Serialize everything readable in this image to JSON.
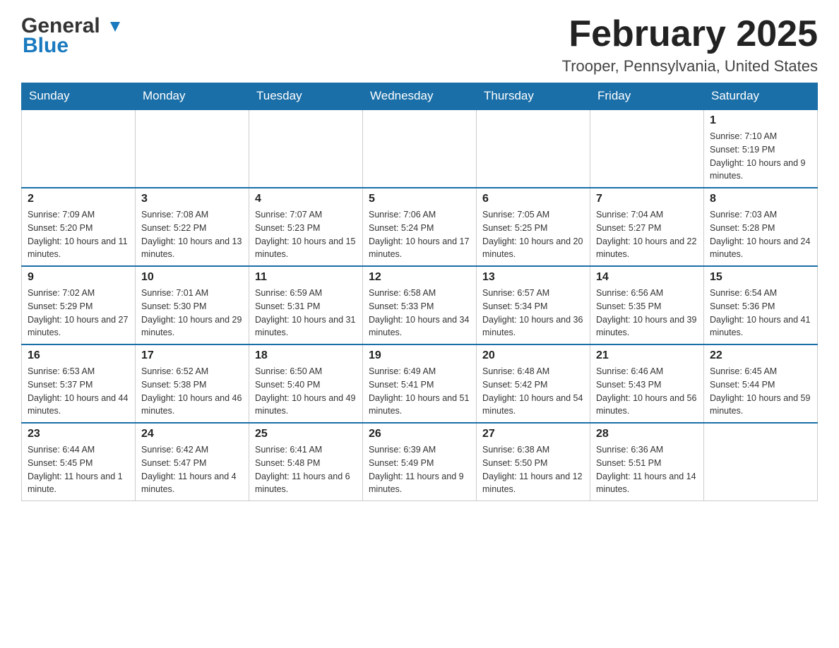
{
  "header": {
    "logo_general": "General",
    "logo_blue": "Blue",
    "month_title": "February 2025",
    "location": "Trooper, Pennsylvania, United States"
  },
  "weekdays": [
    "Sunday",
    "Monday",
    "Tuesday",
    "Wednesday",
    "Thursday",
    "Friday",
    "Saturday"
  ],
  "weeks": [
    {
      "days": [
        {
          "number": "",
          "info": ""
        },
        {
          "number": "",
          "info": ""
        },
        {
          "number": "",
          "info": ""
        },
        {
          "number": "",
          "info": ""
        },
        {
          "number": "",
          "info": ""
        },
        {
          "number": "",
          "info": ""
        },
        {
          "number": "1",
          "info": "Sunrise: 7:10 AM\nSunset: 5:19 PM\nDaylight: 10 hours and 9 minutes."
        }
      ]
    },
    {
      "days": [
        {
          "number": "2",
          "info": "Sunrise: 7:09 AM\nSunset: 5:20 PM\nDaylight: 10 hours and 11 minutes."
        },
        {
          "number": "3",
          "info": "Sunrise: 7:08 AM\nSunset: 5:22 PM\nDaylight: 10 hours and 13 minutes."
        },
        {
          "number": "4",
          "info": "Sunrise: 7:07 AM\nSunset: 5:23 PM\nDaylight: 10 hours and 15 minutes."
        },
        {
          "number": "5",
          "info": "Sunrise: 7:06 AM\nSunset: 5:24 PM\nDaylight: 10 hours and 17 minutes."
        },
        {
          "number": "6",
          "info": "Sunrise: 7:05 AM\nSunset: 5:25 PM\nDaylight: 10 hours and 20 minutes."
        },
        {
          "number": "7",
          "info": "Sunrise: 7:04 AM\nSunset: 5:27 PM\nDaylight: 10 hours and 22 minutes."
        },
        {
          "number": "8",
          "info": "Sunrise: 7:03 AM\nSunset: 5:28 PM\nDaylight: 10 hours and 24 minutes."
        }
      ]
    },
    {
      "days": [
        {
          "number": "9",
          "info": "Sunrise: 7:02 AM\nSunset: 5:29 PM\nDaylight: 10 hours and 27 minutes."
        },
        {
          "number": "10",
          "info": "Sunrise: 7:01 AM\nSunset: 5:30 PM\nDaylight: 10 hours and 29 minutes."
        },
        {
          "number": "11",
          "info": "Sunrise: 6:59 AM\nSunset: 5:31 PM\nDaylight: 10 hours and 31 minutes."
        },
        {
          "number": "12",
          "info": "Sunrise: 6:58 AM\nSunset: 5:33 PM\nDaylight: 10 hours and 34 minutes."
        },
        {
          "number": "13",
          "info": "Sunrise: 6:57 AM\nSunset: 5:34 PM\nDaylight: 10 hours and 36 minutes."
        },
        {
          "number": "14",
          "info": "Sunrise: 6:56 AM\nSunset: 5:35 PM\nDaylight: 10 hours and 39 minutes."
        },
        {
          "number": "15",
          "info": "Sunrise: 6:54 AM\nSunset: 5:36 PM\nDaylight: 10 hours and 41 minutes."
        }
      ]
    },
    {
      "days": [
        {
          "number": "16",
          "info": "Sunrise: 6:53 AM\nSunset: 5:37 PM\nDaylight: 10 hours and 44 minutes."
        },
        {
          "number": "17",
          "info": "Sunrise: 6:52 AM\nSunset: 5:38 PM\nDaylight: 10 hours and 46 minutes."
        },
        {
          "number": "18",
          "info": "Sunrise: 6:50 AM\nSunset: 5:40 PM\nDaylight: 10 hours and 49 minutes."
        },
        {
          "number": "19",
          "info": "Sunrise: 6:49 AM\nSunset: 5:41 PM\nDaylight: 10 hours and 51 minutes."
        },
        {
          "number": "20",
          "info": "Sunrise: 6:48 AM\nSunset: 5:42 PM\nDaylight: 10 hours and 54 minutes."
        },
        {
          "number": "21",
          "info": "Sunrise: 6:46 AM\nSunset: 5:43 PM\nDaylight: 10 hours and 56 minutes."
        },
        {
          "number": "22",
          "info": "Sunrise: 6:45 AM\nSunset: 5:44 PM\nDaylight: 10 hours and 59 minutes."
        }
      ]
    },
    {
      "days": [
        {
          "number": "23",
          "info": "Sunrise: 6:44 AM\nSunset: 5:45 PM\nDaylight: 11 hours and 1 minute."
        },
        {
          "number": "24",
          "info": "Sunrise: 6:42 AM\nSunset: 5:47 PM\nDaylight: 11 hours and 4 minutes."
        },
        {
          "number": "25",
          "info": "Sunrise: 6:41 AM\nSunset: 5:48 PM\nDaylight: 11 hours and 6 minutes."
        },
        {
          "number": "26",
          "info": "Sunrise: 6:39 AM\nSunset: 5:49 PM\nDaylight: 11 hours and 9 minutes."
        },
        {
          "number": "27",
          "info": "Sunrise: 6:38 AM\nSunset: 5:50 PM\nDaylight: 11 hours and 12 minutes."
        },
        {
          "number": "28",
          "info": "Sunrise: 6:36 AM\nSunset: 5:51 PM\nDaylight: 11 hours and 14 minutes."
        },
        {
          "number": "",
          "info": ""
        }
      ]
    }
  ]
}
